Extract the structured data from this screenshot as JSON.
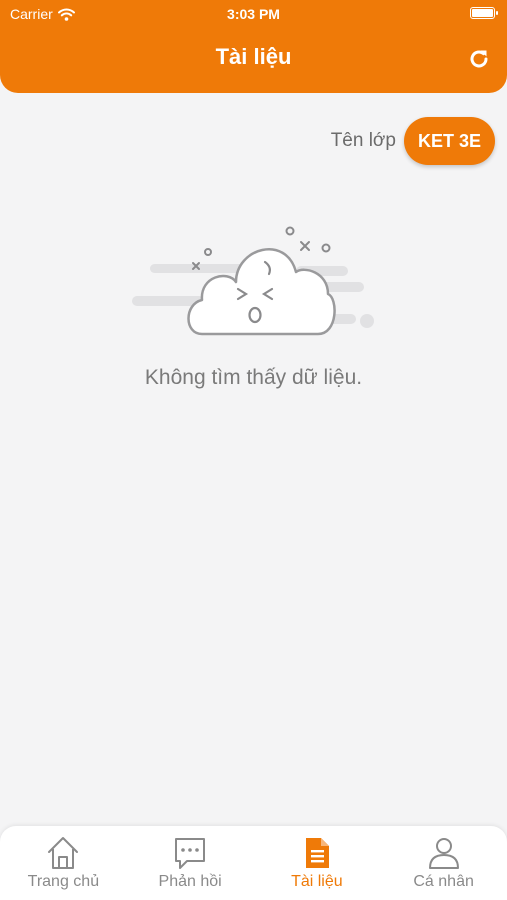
{
  "status_bar": {
    "carrier": "Carrier",
    "time": "3:03 PM"
  },
  "header": {
    "title": "Tài liệu",
    "refresh_icon": "refresh-icon"
  },
  "class_selector": {
    "label": "Tên lớp",
    "value": "KET 3E"
  },
  "empty_state": {
    "message": "Không tìm thấy dữ liệu.",
    "illustration": "sad-cloud-icon"
  },
  "tabs": [
    {
      "label": "Trang chủ",
      "icon": "home-icon",
      "active": false
    },
    {
      "label": "Phản hồi",
      "icon": "chat-icon",
      "active": false
    },
    {
      "label": "Tài liệu",
      "icon": "document-icon",
      "active": true
    },
    {
      "label": "Cá nhân",
      "icon": "person-icon",
      "active": false
    }
  ],
  "colors": {
    "accent": "#ef7a08",
    "background": "#f4f4f5",
    "inactive": "#8a8a8a"
  }
}
